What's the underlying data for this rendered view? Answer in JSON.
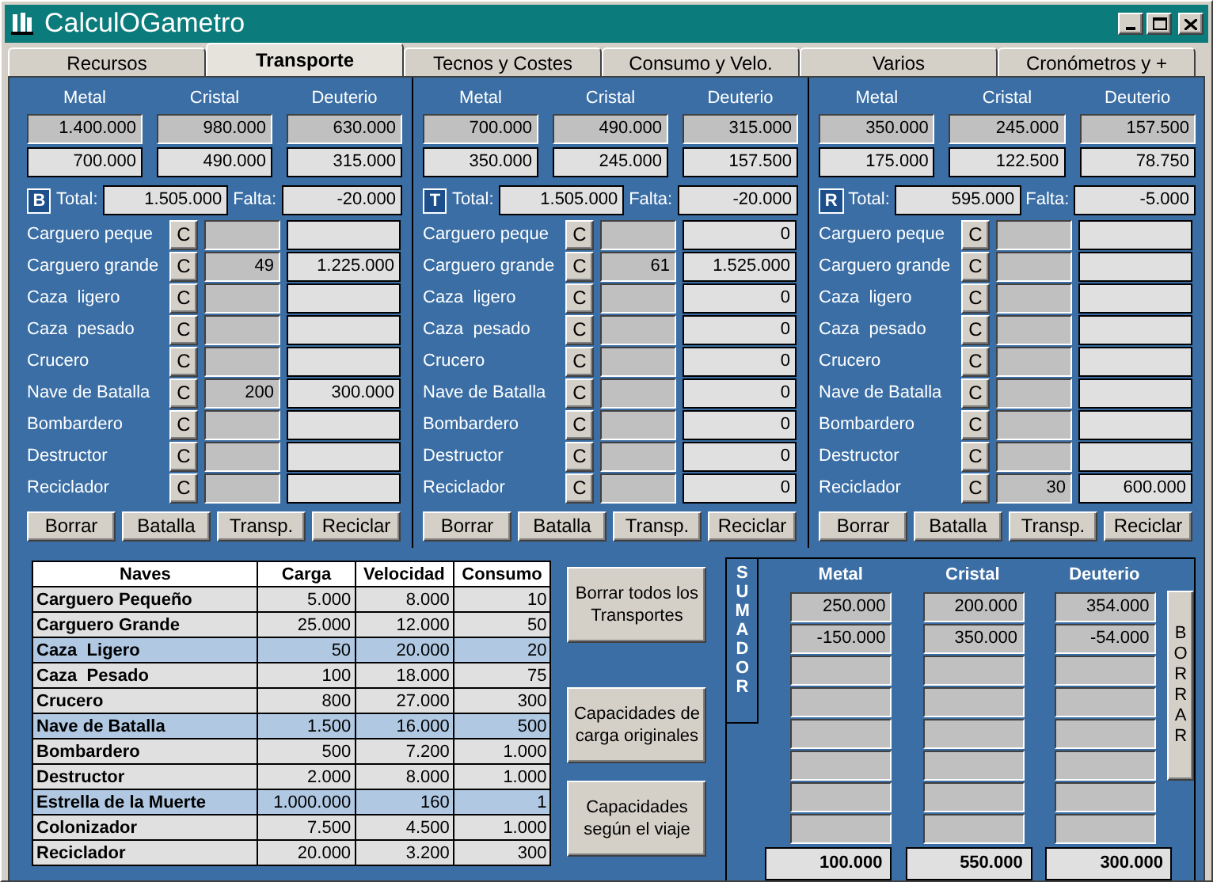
{
  "window": {
    "title": "CalculOGametro"
  },
  "tabs": [
    {
      "label": "Recursos",
      "selected": false
    },
    {
      "label": "Transporte",
      "selected": true
    },
    {
      "label": "Tecnos y Costes",
      "selected": false
    },
    {
      "label": "Consumo y Velo.",
      "selected": false
    },
    {
      "label": "Varios",
      "selected": false
    },
    {
      "label": "Cronómetros y +",
      "selected": false
    }
  ],
  "fleets": [
    {
      "headers": [
        "Metal",
        "Cristal",
        "Deuterio"
      ],
      "costs": [
        [
          "1.400.000",
          "980.000",
          "630.000"
        ],
        [
          "700.000",
          "490.000",
          "315.000"
        ]
      ],
      "letter": "B",
      "total_label": "Total:",
      "total": "1.505.000",
      "falta_label": "Falta:",
      "falta": "-20.000",
      "ships": [
        {
          "name": "Carguero peque",
          "button": "C"
        },
        {
          "name": "Carguero grande",
          "button": "C",
          "count": "49",
          "value": "1.225.000"
        },
        {
          "name": "Caza  ligero",
          "button": "C"
        },
        {
          "name": "Caza  pesado",
          "button": "C"
        },
        {
          "name": "Crucero",
          "button": "C"
        },
        {
          "name": "Nave de Batalla",
          "button": "C",
          "count": "200",
          "value": "300.000"
        },
        {
          "name": "Bombardero",
          "button": "C"
        },
        {
          "name": "Destructor",
          "button": "C"
        },
        {
          "name": "Reciclador",
          "button": "C"
        }
      ],
      "buttons": [
        "Borrar",
        "Batalla",
        "Transp.",
        "Reciclar"
      ]
    },
    {
      "headers": [
        "Metal",
        "Cristal",
        "Deuterio"
      ],
      "costs": [
        [
          "700.000",
          "490.000",
          "315.000"
        ],
        [
          "350.000",
          "245.000",
          "157.500"
        ]
      ],
      "letter": "T",
      "total_label": "Total:",
      "total": "1.505.000",
      "falta_label": "Falta:",
      "falta": "-20.000",
      "ships": [
        {
          "name": "Carguero peque",
          "button": "C",
          "value": "0"
        },
        {
          "name": "Carguero grande",
          "button": "C",
          "count": "61",
          "value": "1.525.000"
        },
        {
          "name": "Caza  ligero",
          "button": "C",
          "value": "0"
        },
        {
          "name": "Caza  pesado",
          "button": "C",
          "value": "0"
        },
        {
          "name": "Crucero",
          "button": "C",
          "value": "0"
        },
        {
          "name": "Nave de Batalla",
          "button": "C",
          "value": "0"
        },
        {
          "name": "Bombardero",
          "button": "C",
          "value": "0"
        },
        {
          "name": "Destructor",
          "button": "C",
          "value": "0"
        },
        {
          "name": "Reciclador",
          "button": "C",
          "value": "0"
        }
      ],
      "buttons": [
        "Borrar",
        "Batalla",
        "Transp.",
        "Reciclar"
      ]
    },
    {
      "headers": [
        "Metal",
        "Cristal",
        "Deuterio"
      ],
      "costs": [
        [
          "350.000",
          "245.000",
          "157.500"
        ],
        [
          "175.000",
          "122.500",
          "78.750"
        ]
      ],
      "letter": "R",
      "total_label": "Total:",
      "total": "595.000",
      "falta_label": "Falta:",
      "falta": "-5.000",
      "ships": [
        {
          "name": "Carguero peque",
          "button": "C"
        },
        {
          "name": "Carguero grande",
          "button": "C"
        },
        {
          "name": "Caza  ligero",
          "button": "C"
        },
        {
          "name": "Caza  pesado",
          "button": "C"
        },
        {
          "name": "Crucero",
          "button": "C"
        },
        {
          "name": "Nave de Batalla",
          "button": "C"
        },
        {
          "name": "Bombardero",
          "button": "C"
        },
        {
          "name": "Destructor",
          "button": "C"
        },
        {
          "name": "Reciclador",
          "button": "C",
          "count": "30",
          "value": "600.000"
        }
      ],
      "buttons": [
        "Borrar",
        "Batalla",
        "Transp.",
        "Reciclar"
      ]
    }
  ],
  "ships_table": {
    "columns": [
      "Naves",
      "Carga",
      "Velocidad",
      "Consumo"
    ],
    "rows": [
      {
        "cells": [
          "Carguero Pequeño",
          "5.000",
          "8.000",
          "10"
        ],
        "highlighted": false
      },
      {
        "cells": [
          "Carguero Grande",
          "25.000",
          "12.000",
          "50"
        ],
        "highlighted": false
      },
      {
        "cells": [
          "Caza  Ligero",
          "50",
          "20.000",
          "20"
        ],
        "highlighted": true
      },
      {
        "cells": [
          "Caza  Pesado",
          "100",
          "18.000",
          "75"
        ],
        "highlighted": false
      },
      {
        "cells": [
          "Crucero",
          "800",
          "27.000",
          "300"
        ],
        "highlighted": false
      },
      {
        "cells": [
          "Nave de Batalla",
          "1.500",
          "16.000",
          "500"
        ],
        "highlighted": true
      },
      {
        "cells": [
          "Bombardero",
          "500",
          "7.200",
          "1.000"
        ],
        "highlighted": false
      },
      {
        "cells": [
          "Destructor",
          "2.000",
          "8.000",
          "1.000"
        ],
        "highlighted": false
      },
      {
        "cells": [
          "Estrella de la Muerte",
          "1.000.000",
          "160",
          "1"
        ],
        "highlighted": true
      },
      {
        "cells": [
          "Colonizador",
          "7.500",
          "4.500",
          "1.000"
        ],
        "highlighted": false
      },
      {
        "cells": [
          "Reciclador",
          "20.000",
          "3.200",
          "300"
        ],
        "highlighted": false
      }
    ]
  },
  "actions": [
    "Borrar todos los Transportes",
    "Capacidades de carga originales",
    "Capacidades según el viaje"
  ],
  "sumador": {
    "label": "SUMADOR",
    "headers": [
      "Metal",
      "Cristal",
      "Deuterio"
    ],
    "rows": [
      {
        "values": [
          "250.000",
          "200.000",
          "354.000"
        ]
      },
      {
        "values": [
          "-150.000",
          "350.000",
          "-54.000"
        ]
      },
      {},
      {},
      {},
      {},
      {},
      {}
    ],
    "totals": [
      "100.000",
      "550.000",
      "300.000"
    ],
    "clear_button": "BORRAR"
  }
}
